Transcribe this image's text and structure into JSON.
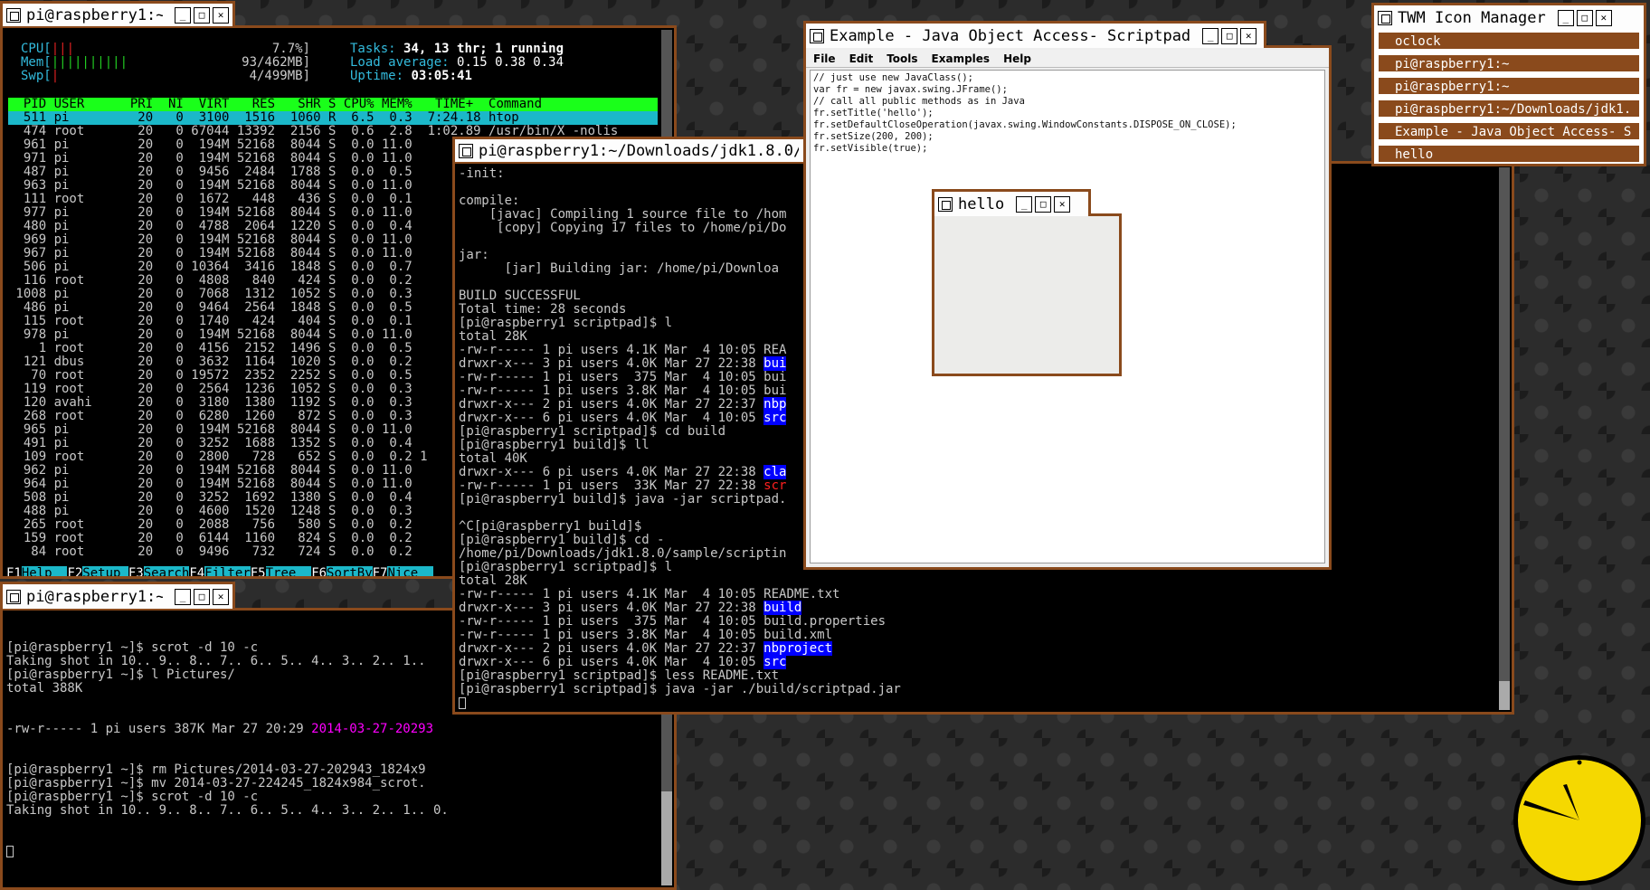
{
  "htop": {
    "title": "pi@raspberry1:~",
    "cpu_label": "CPU[",
    "cpu_bar": "|||",
    "cpu_value": "7.7%]",
    "mem_label": "Mem[",
    "mem_bar": "||||||||||",
    "mem_value": "93/462MB]",
    "swp_label": "Swp[",
    "swp_value": "4/499MB]",
    "tasks_label": "Tasks:",
    "tasks_value": "34, 13 thr; 1 running",
    "load_label": "Load average:",
    "load_value": "0.15 0.38 0.34",
    "uptime_label": "Uptime:",
    "uptime_value": "03:05:41",
    "header": "  PID USER      PRI  NI  VIRT   RES   SHR S CPU% MEM%   TIME+  Command",
    "rows": [
      "  511 pi         20   0  3100  1516  1060 R  6.5  0.3  7:24.18 htop",
      "  474 root       20   0 67044 13392  2156 S  0.6  2.8  1:02.89 /usr/bin/X -nolis",
      "  961 pi         20   0  194M 52168  8044 S  0.0 11.0",
      "  971 pi         20   0  194M 52168  8044 S  0.0 11.0",
      "  487 pi         20   0  9456  2484  1788 S  0.0  0.5",
      "  963 pi         20   0  194M 52168  8044 S  0.0 11.0",
      "  111 root       20   0  1672   448   436 S  0.0  0.1",
      "  977 pi         20   0  194M 52168  8044 S  0.0 11.0",
      "  480 pi         20   0  4788  2064  1220 S  0.0  0.4",
      "  969 pi         20   0  194M 52168  8044 S  0.0 11.0",
      "  967 pi         20   0  194M 52168  8044 S  0.0 11.0",
      "  506 pi         20   0 10364  3416  1848 S  0.0  0.7",
      "  116 root       20   0  4808   840   424 S  0.0  0.2",
      " 1008 pi         20   0  7068  1312  1052 S  0.0  0.3",
      "  486 pi         20   0  9464  2564  1848 S  0.0  0.5",
      "  115 root       20   0  1740   424   404 S  0.0  0.1",
      "  978 pi         20   0  194M 52168  8044 S  0.0 11.0",
      "    1 root       20   0  4156  2152  1496 S  0.0  0.5",
      "  121 dbus       20   0  3632  1164  1020 S  0.0  0.2",
      "   70 root       20   0 19572  2352  2252 S  0.0  0.5",
      "  119 root       20   0  2564  1236  1052 S  0.0  0.3",
      "  120 avahi      20   0  3180  1380  1192 S  0.0  0.3",
      "  268 root       20   0  6280  1260   872 S  0.0  0.3",
      "  965 pi         20   0  194M 52168  8044 S  0.0 11.0",
      "  491 pi         20   0  3252  1688  1352 S  0.0  0.4",
      "  109 root       20   0  2800   728   652 S  0.0  0.2 1",
      "  962 pi         20   0  194M 52168  8044 S  0.0 11.0",
      "  964 pi         20   0  194M 52168  8044 S  0.0 11.0",
      "  508 pi         20   0  3252  1692  1380 S  0.0  0.4",
      "  488 pi         20   0  4600  1520  1248 S  0.0  0.3",
      "  265 root       20   0  2088   756   580 S  0.0  0.2",
      "  159 root       20   0  6144  1160   824 S  0.0  0.2",
      "   84 root       20   0  9496   732   724 S  0.0  0.2"
    ],
    "fkeys": [
      {
        "k": "F1",
        "l": "Help  "
      },
      {
        "k": "F2",
        "l": "Setup "
      },
      {
        "k": "F3",
        "l": "Search"
      },
      {
        "k": "F4",
        "l": "Filter"
      },
      {
        "k": "F5",
        "l": "Tree  "
      },
      {
        "k": "F6",
        "l": "SortBy"
      },
      {
        "k": "F7",
        "l": "Nice  "
      }
    ]
  },
  "term2": {
    "title": "pi@raspberry1:~",
    "lines": [
      "[pi@raspberry1 ~]$ scrot -d 10 -c",
      "Taking shot in 10.. 9.. 8.. 7.. 6.. 5.. 4.. 3.. 2.. 1..",
      "[pi@raspberry1 ~]$ l Pictures/",
      "total 388K"
    ],
    "ls_line_prefix": "-rw-r----- 1 pi users 387K Mar 27 20:29 ",
    "ls_line_file": "2014-03-27-20293",
    "lines2": [
      "[pi@raspberry1 ~]$ rm Pictures/2014-03-27-202943_1824x9",
      "[pi@raspberry1 ~]$ mv 2014-03-27-224245_1824x984_scrot.",
      "[pi@raspberry1 ~]$ scrot -d 10 -c",
      "Taking shot in 10.. 9.. 8.. 7.. 6.. 5.. 4.. 3.. 2.. 1.. 0."
    ]
  },
  "term3": {
    "title": "pi@raspberry1:~/Downloads/jdk1.8.0/s",
    "lines": [
      "-init:",
      "",
      "compile:",
      "    [javac] Compiling 1 source file to /hom",
      "     [copy] Copying 17 files to /home/pi/Do",
      "",
      "jar:",
      "      [jar] Building jar: /home/pi/Downloa",
      "",
      "BUILD SUCCESSFUL",
      "Total time: 28 seconds",
      "[pi@raspberry1 scriptpad]$ l",
      "total 28K"
    ],
    "ls1": [
      {
        "p": "-rw-r----- 1 pi users 4.1K Mar  4 10:05 ",
        "f": "REA",
        "c": ""
      },
      {
        "p": "drwxr-x--- 3 pi users 4.0K Mar 27 22:38 ",
        "f": "bui",
        "c": "blue"
      },
      {
        "p": "-rw-r----- 1 pi users  375 Mar  4 10:05 ",
        "f": "bui",
        "c": ""
      },
      {
        "p": "-rw-r----- 1 pi users 3.8K Mar  4 10:05 ",
        "f": "bui",
        "c": ""
      },
      {
        "p": "drwxr-x--- 2 pi users 4.0K Mar 27 22:37 ",
        "f": "nbp",
        "c": "blue"
      },
      {
        "p": "drwxr-x--- 6 pi users 4.0K Mar  4 10:05 ",
        "f": "src",
        "c": "blue"
      }
    ],
    "mid": [
      "[pi@raspberry1 scriptpad]$ cd build",
      "[pi@raspberry1 build]$ ll",
      "total 40K"
    ],
    "ls2": [
      {
        "p": "drwxr-x--- 6 pi users 4.0K Mar 27 22:38 ",
        "f": "cla",
        "c": "blue"
      },
      {
        "p": "-rw-r----- 1 pi users  33K Mar 27 22:38 ",
        "f": "scr",
        "c": "red"
      }
    ],
    "mid2": [
      "[pi@raspberry1 build]$ java -jar scriptpad.",
      "",
      "^C[pi@raspberry1 build]$",
      "[pi@raspberry1 build]$ cd -",
      "/home/pi/Downloads/jdk1.8.0/sample/scriptin",
      "[pi@raspberry1 scriptpad]$ l",
      "total 28K"
    ],
    "ls3": [
      {
        "p": "-rw-r----- 1 pi users 4.1K Mar  4 10:05 ",
        "f": "README.txt",
        "c": ""
      },
      {
        "p": "drwxr-x--- 3 pi users 4.0K Mar 27 22:38 ",
        "f": "build",
        "c": "blue"
      },
      {
        "p": "-rw-r----- 1 pi users  375 Mar  4 10:05 ",
        "f": "build.properties",
        "c": ""
      },
      {
        "p": "-rw-r----- 1 pi users 3.8K Mar  4 10:05 ",
        "f": "build.xml",
        "c": ""
      },
      {
        "p": "drwxr-x--- 2 pi users 4.0K Mar 27 22:37 ",
        "f": "nbproject",
        "c": "blue"
      },
      {
        "p": "drwxr-x--- 6 pi users 4.0K Mar  4 10:05 ",
        "f": "src",
        "c": "blue"
      }
    ],
    "end": [
      "[pi@raspberry1 scriptpad]$ less README.txt",
      "[pi@raspberry1 scriptpad]$ java -jar ./build/scriptpad.jar"
    ]
  },
  "scriptpad": {
    "title": "Example - Java Object Access- Scriptpad",
    "menu": [
      "File",
      "Edit",
      "Tools",
      "Examples",
      "Help"
    ],
    "code": [
      "// just use new JavaClass();",
      "var fr = new javax.swing.JFrame();",
      "// call all public methods as in Java",
      "fr.setTitle('hello');",
      "fr.setDefaultCloseOperation(javax.swing.WindowConstants.DISPOSE_ON_CLOSE);",
      "fr.setSize(200, 200);",
      "fr.setVisible(true);"
    ]
  },
  "hello": {
    "title": "hello"
  },
  "iconmgr": {
    "title": "TWM Icon Manager",
    "items": [
      "oclock",
      "pi@raspberry1:~",
      "pi@raspberry1:~",
      "pi@raspberry1:~/Downloads/jdk1.",
      "Example - Java Object Access- S",
      "hello"
    ]
  },
  "clock": {
    "face_color": "#f5d800",
    "border_color": "#000000"
  },
  "colors": {
    "frame": "#8a4a1c",
    "htop_header": "#1aff1a",
    "htop_sel": "#1bb8c9",
    "dir": "#0000ff"
  }
}
